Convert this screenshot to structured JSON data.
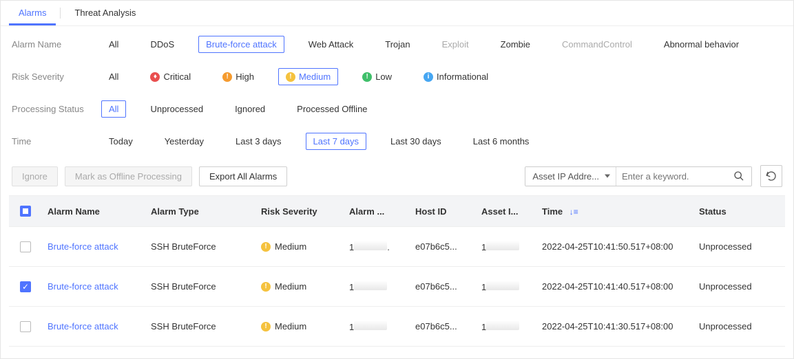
{
  "tabs": {
    "alarms": "Alarms",
    "threat": "Threat Analysis",
    "active": "alarms"
  },
  "filters": {
    "alarm_name": {
      "label": "Alarm Name",
      "options": [
        "All",
        "DDoS",
        "Brute-force attack",
        "Web Attack",
        "Trojan",
        "Exploit",
        "Zombie",
        "CommandControl",
        "Abnormal behavior"
      ],
      "dimmed": [
        "Exploit",
        "CommandControl"
      ],
      "selected": "Brute-force attack"
    },
    "risk_severity": {
      "label": "Risk Severity",
      "options": [
        "All",
        "Critical",
        "High",
        "Medium",
        "Low",
        "Informational"
      ],
      "selected": "Medium"
    },
    "processing_status": {
      "label": "Processing Status",
      "options": [
        "All",
        "Unprocessed",
        "Ignored",
        "Processed Offline"
      ],
      "selected": "All"
    },
    "time": {
      "label": "Time",
      "options": [
        "Today",
        "Yesterday",
        "Last 3 days",
        "Last 7 days",
        "Last 30 days",
        "Last 6 months"
      ],
      "selected": "Last 7 days"
    }
  },
  "actions": {
    "ignore": "Ignore",
    "mark_offline": "Mark as Offline Processing",
    "export": "Export All Alarms"
  },
  "search": {
    "field_selected": "Asset IP Addre...",
    "placeholder": "Enter a keyword."
  },
  "columns": {
    "alarm_name": "Alarm Name",
    "alarm_type": "Alarm Type",
    "risk_severity": "Risk Severity",
    "alarm_trunc": "Alarm ...",
    "host_id": "Host ID",
    "asset_trunc": "Asset I...",
    "time": "Time",
    "status": "Status"
  },
  "rows": [
    {
      "checked": false,
      "alarm_name": "Brute-force attack",
      "alarm_type": "SSH BruteForce",
      "risk_severity": "Medium",
      "alarm_prefix": "1",
      "alarm_suffix": ".",
      "host_id": "e07b6c5...",
      "asset_prefix": "1",
      "time": "2022-04-25T10:41:50.517+08:00",
      "status": "Unprocessed"
    },
    {
      "checked": true,
      "alarm_name": "Brute-force attack",
      "alarm_type": "SSH BruteForce",
      "risk_severity": "Medium",
      "alarm_prefix": "1",
      "alarm_suffix": "",
      "host_id": "e07b6c5...",
      "asset_prefix": "1",
      "time": "2022-04-25T10:41:40.517+08:00",
      "status": "Unprocessed"
    },
    {
      "checked": false,
      "alarm_name": "Brute-force attack",
      "alarm_type": "SSH BruteForce",
      "risk_severity": "Medium",
      "alarm_prefix": "1",
      "alarm_suffix": "",
      "host_id": "e07b6c5...",
      "asset_prefix": "1",
      "time": "2022-04-25T10:41:30.517+08:00",
      "status": "Unprocessed"
    }
  ]
}
